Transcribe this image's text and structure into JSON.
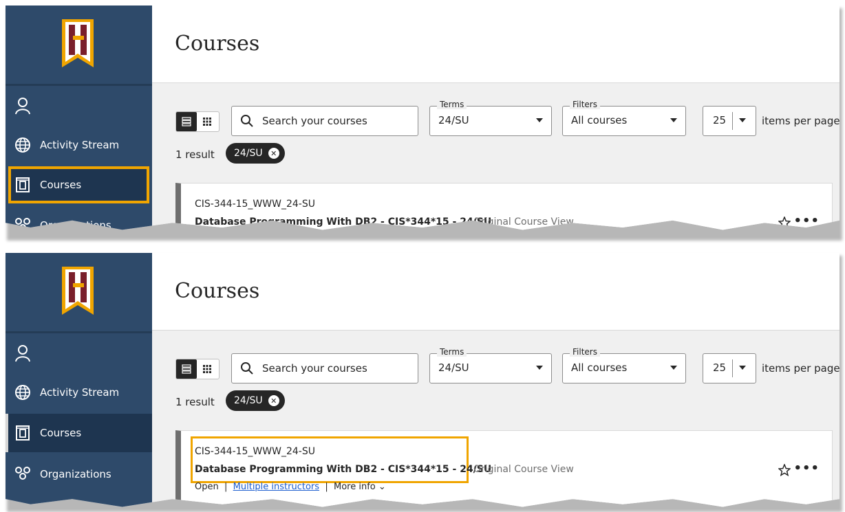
{
  "brand": {
    "logo_icon": "banner-h-logo"
  },
  "panels": [
    {
      "id": "before",
      "nav": [
        {
          "label": "",
          "icon": "person-icon",
          "state": "normal"
        },
        {
          "label": "Activity Stream",
          "icon": "globe-icon",
          "state": "normal"
        },
        {
          "label": "Courses",
          "icon": "courses-icon",
          "state": "highlighted"
        },
        {
          "label": "Organizations",
          "icon": "organizations-icon",
          "state": "normal"
        }
      ],
      "highlight": "courses-nav-item"
    },
    {
      "id": "after",
      "nav": [
        {
          "label": "",
          "icon": "person-icon",
          "state": "normal"
        },
        {
          "label": "Activity Stream",
          "icon": "globe-icon",
          "state": "normal"
        },
        {
          "label": "Courses",
          "icon": "courses-icon",
          "state": "selected"
        },
        {
          "label": "Organizations",
          "icon": "organizations-icon",
          "state": "normal"
        }
      ],
      "highlight": "course-title-block"
    }
  ],
  "page": {
    "title": "Courses"
  },
  "toolbar": {
    "search_placeholder": "Search your courses",
    "terms_label": "Terms",
    "terms_value": "24/SU",
    "filters_label": "Filters",
    "filters_value": "All courses",
    "per_page_value": "25",
    "per_page_label": "items per page"
  },
  "results": {
    "count_text": "1 result",
    "chip_label": "24/SU"
  },
  "course": {
    "id": "CIS-344-15_WWW_24-SU",
    "title": "Database Programming With DB2 - CIS*344*15 - 24/SU",
    "view": "Original Course View",
    "status": "Open",
    "instructors_link": "Multiple instructors",
    "more_info": "More info"
  },
  "colors": {
    "sidebar": "#2e4a6a",
    "highlight": "#f0a500",
    "logo_maroon": "#7a1f2b",
    "logo_gold": "#f0a500"
  }
}
